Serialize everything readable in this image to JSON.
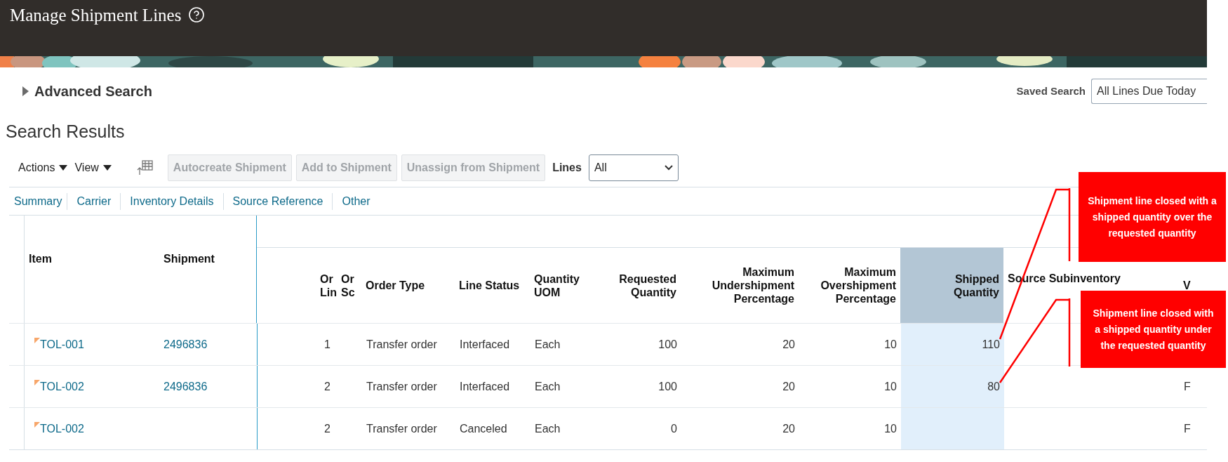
{
  "page": {
    "title": "Manage Shipment Lines"
  },
  "advanced_search": {
    "label": "Advanced Search",
    "expanded": false
  },
  "saved_search": {
    "label": "Saved Search",
    "value": "All Lines Due Today"
  },
  "results": {
    "title": "Search Results",
    "menus": [
      "Actions",
      "View"
    ],
    "buttons": [
      {
        "label": "Autocreate Shipment",
        "disabled": true
      },
      {
        "label": "Add to Shipment",
        "disabled": true
      },
      {
        "label": "Unassign from Shipment",
        "disabled": true
      }
    ],
    "lines_filter": {
      "label": "Lines",
      "value": "All"
    }
  },
  "tabs": [
    "Summary",
    "Carrier",
    "Inventory Details",
    "Source Reference",
    "Other"
  ],
  "table": {
    "columns": [
      {
        "label": "Item",
        "selected": false
      },
      {
        "label": "Shipment",
        "selected": false
      },
      {
        "label": "Or Lin",
        "selected": false
      },
      {
        "label": "Or Sc",
        "selected": false
      },
      {
        "label": "Order Type",
        "selected": false
      },
      {
        "label": "Line Status",
        "selected": false
      },
      {
        "label": "Quantity UOM",
        "selected": false
      },
      {
        "label": "Requested Quantity",
        "selected": false
      },
      {
        "label": "Maximum Undershipment Percentage",
        "selected": false
      },
      {
        "label": "Maximum Overshipment Percentage",
        "selected": false
      },
      {
        "label": "Shipped Quantity",
        "selected": true
      },
      {
        "label": "Source Subinventory",
        "selected": false
      },
      {
        "label": "V",
        "selected": false
      }
    ],
    "rows": [
      {
        "cells": [
          "TOL-001",
          "2496836",
          "1",
          "",
          "Transfer order",
          "Interfaced",
          "Each",
          "100",
          "20",
          "10",
          "110",
          "",
          ""
        ]
      },
      {
        "cells": [
          "TOL-002",
          "2496836",
          "2",
          "",
          "Transfer order",
          "Interfaced",
          "Each",
          "100",
          "20",
          "10",
          "80",
          "",
          "F"
        ]
      },
      {
        "cells": [
          "TOL-002",
          "",
          "2",
          "",
          "Transfer order",
          "Canceled",
          "Each",
          "0",
          "20",
          "10",
          "",
          "",
          "F"
        ]
      }
    ]
  },
  "callouts": [
    "Shipment line closed with a shipped quantity over the requested quantity",
    "Shipment line closed with a shipped quantity under the requested quantity"
  ]
}
